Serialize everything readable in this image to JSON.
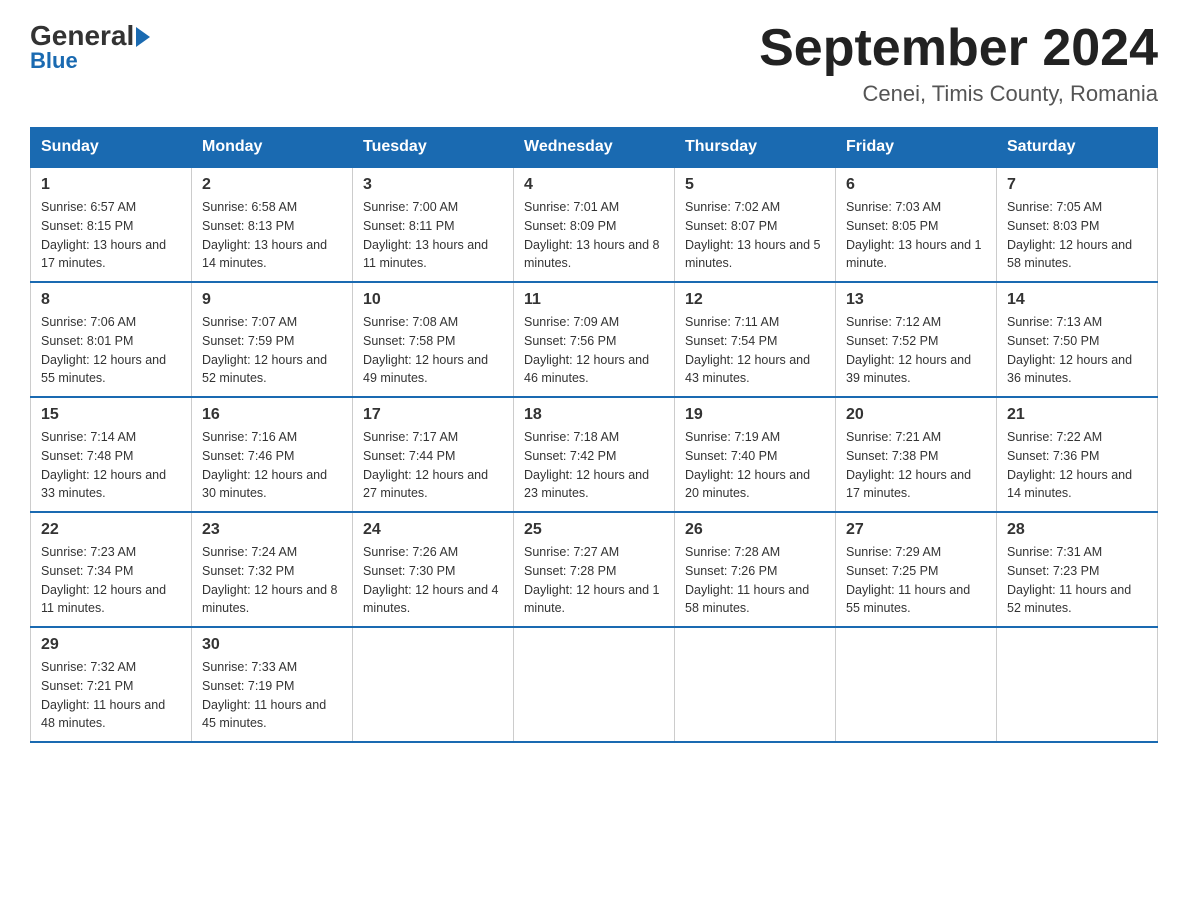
{
  "logo": {
    "text_general": "General",
    "text_blue": "Blue"
  },
  "title": "September 2024",
  "subtitle": "Cenei, Timis County, Romania",
  "days_of_week": [
    "Sunday",
    "Monday",
    "Tuesday",
    "Wednesday",
    "Thursday",
    "Friday",
    "Saturday"
  ],
  "weeks": [
    [
      {
        "day": "1",
        "sunrise": "6:57 AM",
        "sunset": "8:15 PM",
        "daylight": "13 hours and 17 minutes."
      },
      {
        "day": "2",
        "sunrise": "6:58 AM",
        "sunset": "8:13 PM",
        "daylight": "13 hours and 14 minutes."
      },
      {
        "day": "3",
        "sunrise": "7:00 AM",
        "sunset": "8:11 PM",
        "daylight": "13 hours and 11 minutes."
      },
      {
        "day": "4",
        "sunrise": "7:01 AM",
        "sunset": "8:09 PM",
        "daylight": "13 hours and 8 minutes."
      },
      {
        "day": "5",
        "sunrise": "7:02 AM",
        "sunset": "8:07 PM",
        "daylight": "13 hours and 5 minutes."
      },
      {
        "day": "6",
        "sunrise": "7:03 AM",
        "sunset": "8:05 PM",
        "daylight": "13 hours and 1 minute."
      },
      {
        "day": "7",
        "sunrise": "7:05 AM",
        "sunset": "8:03 PM",
        "daylight": "12 hours and 58 minutes."
      }
    ],
    [
      {
        "day": "8",
        "sunrise": "7:06 AM",
        "sunset": "8:01 PM",
        "daylight": "12 hours and 55 minutes."
      },
      {
        "day": "9",
        "sunrise": "7:07 AM",
        "sunset": "7:59 PM",
        "daylight": "12 hours and 52 minutes."
      },
      {
        "day": "10",
        "sunrise": "7:08 AM",
        "sunset": "7:58 PM",
        "daylight": "12 hours and 49 minutes."
      },
      {
        "day": "11",
        "sunrise": "7:09 AM",
        "sunset": "7:56 PM",
        "daylight": "12 hours and 46 minutes."
      },
      {
        "day": "12",
        "sunrise": "7:11 AM",
        "sunset": "7:54 PM",
        "daylight": "12 hours and 43 minutes."
      },
      {
        "day": "13",
        "sunrise": "7:12 AM",
        "sunset": "7:52 PM",
        "daylight": "12 hours and 39 minutes."
      },
      {
        "day": "14",
        "sunrise": "7:13 AM",
        "sunset": "7:50 PM",
        "daylight": "12 hours and 36 minutes."
      }
    ],
    [
      {
        "day": "15",
        "sunrise": "7:14 AM",
        "sunset": "7:48 PM",
        "daylight": "12 hours and 33 minutes."
      },
      {
        "day": "16",
        "sunrise": "7:16 AM",
        "sunset": "7:46 PM",
        "daylight": "12 hours and 30 minutes."
      },
      {
        "day": "17",
        "sunrise": "7:17 AM",
        "sunset": "7:44 PM",
        "daylight": "12 hours and 27 minutes."
      },
      {
        "day": "18",
        "sunrise": "7:18 AM",
        "sunset": "7:42 PM",
        "daylight": "12 hours and 23 minutes."
      },
      {
        "day": "19",
        "sunrise": "7:19 AM",
        "sunset": "7:40 PM",
        "daylight": "12 hours and 20 minutes."
      },
      {
        "day": "20",
        "sunrise": "7:21 AM",
        "sunset": "7:38 PM",
        "daylight": "12 hours and 17 minutes."
      },
      {
        "day": "21",
        "sunrise": "7:22 AM",
        "sunset": "7:36 PM",
        "daylight": "12 hours and 14 minutes."
      }
    ],
    [
      {
        "day": "22",
        "sunrise": "7:23 AM",
        "sunset": "7:34 PM",
        "daylight": "12 hours and 11 minutes."
      },
      {
        "day": "23",
        "sunrise": "7:24 AM",
        "sunset": "7:32 PM",
        "daylight": "12 hours and 8 minutes."
      },
      {
        "day": "24",
        "sunrise": "7:26 AM",
        "sunset": "7:30 PM",
        "daylight": "12 hours and 4 minutes."
      },
      {
        "day": "25",
        "sunrise": "7:27 AM",
        "sunset": "7:28 PM",
        "daylight": "12 hours and 1 minute."
      },
      {
        "day": "26",
        "sunrise": "7:28 AM",
        "sunset": "7:26 PM",
        "daylight": "11 hours and 58 minutes."
      },
      {
        "day": "27",
        "sunrise": "7:29 AM",
        "sunset": "7:25 PM",
        "daylight": "11 hours and 55 minutes."
      },
      {
        "day": "28",
        "sunrise": "7:31 AM",
        "sunset": "7:23 PM",
        "daylight": "11 hours and 52 minutes."
      }
    ],
    [
      {
        "day": "29",
        "sunrise": "7:32 AM",
        "sunset": "7:21 PM",
        "daylight": "11 hours and 48 minutes."
      },
      {
        "day": "30",
        "sunrise": "7:33 AM",
        "sunset": "7:19 PM",
        "daylight": "11 hours and 45 minutes."
      },
      {
        "day": "",
        "sunrise": "",
        "sunset": "",
        "daylight": ""
      },
      {
        "day": "",
        "sunrise": "",
        "sunset": "",
        "daylight": ""
      },
      {
        "day": "",
        "sunrise": "",
        "sunset": "",
        "daylight": ""
      },
      {
        "day": "",
        "sunrise": "",
        "sunset": "",
        "daylight": ""
      },
      {
        "day": "",
        "sunrise": "",
        "sunset": "",
        "daylight": ""
      }
    ]
  ]
}
